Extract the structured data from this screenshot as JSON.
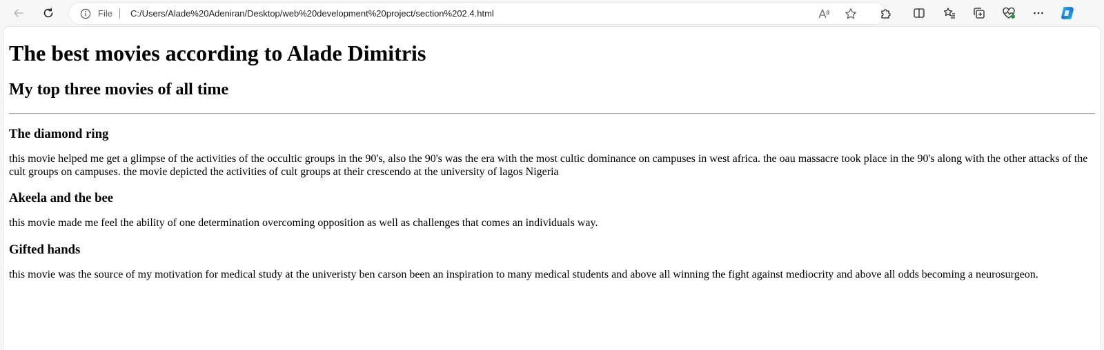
{
  "browser": {
    "address_scheme": "File",
    "url": "C:/Users/Alade%20Adeniran/Desktop/web%20development%20project/section%202.4.html",
    "icons": {
      "back": "back-arrow-icon",
      "refresh": "refresh-icon",
      "info": "info-icon",
      "read_aloud": "read-aloud-icon",
      "favorite": "star-icon",
      "extensions": "puzzle-icon",
      "split_screen": "split-screen-icon",
      "favorites_list": "favorites-icon",
      "collections": "collections-icon",
      "performance": "heart-pulse-icon",
      "more": "more-dots-icon",
      "copilot": "copilot-icon"
    },
    "accent_color": "#1a73e8"
  },
  "page": {
    "title": "The best movies according to Alade Dimitris",
    "subtitle": "My top three movies of all time",
    "movies": [
      {
        "name": "The diamond ring",
        "description": "this movie helped me get a glimpse of the activities of the occultic groups in the 90's, also the 90's was the era with the most cultic dominance on campuses in west africa. the oau massacre took place in the 90's along with the other attacks of the cult groups on campuses. the movie depicted the activities of cult groups at their crescendo at the university of lagos Nigeria"
      },
      {
        "name": "Akeela and the bee",
        "description": "this movie made me feel the ability of one determination overcoming opposition as well as challenges that comes an individuals way."
      },
      {
        "name": "Gifted hands",
        "description": "this movie was the source of my motivation for medical study at the univeristy ben carson been an inspiration to many medical students and above all winning the fight against mediocrity and above all odds becoming a neurosurgeon."
      }
    ]
  }
}
